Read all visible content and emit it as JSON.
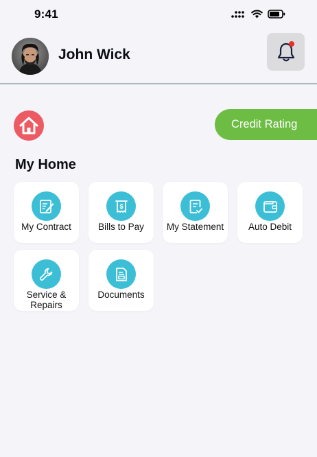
{
  "status_bar": {
    "time": "9:41"
  },
  "header": {
    "user_name": "John Wick"
  },
  "actions": {
    "credit_rating_label": "Credit Rating"
  },
  "section": {
    "title": "My Home"
  },
  "tiles": [
    {
      "label": "My Contract",
      "icon": "contract-icon"
    },
    {
      "label": "Bills to Pay",
      "icon": "bill-icon"
    },
    {
      "label": "My Statement",
      "icon": "statement-icon"
    },
    {
      "label": "Auto Debit",
      "icon": "wallet-icon"
    },
    {
      "label_line1": "Service &",
      "label_line2": "Repairs",
      "icon": "wrench-icon"
    },
    {
      "label": "Documents",
      "icon": "document-icon"
    }
  ],
  "colors": {
    "accent_teal": "#3cbfd6",
    "credit_green": "#6dbd45",
    "home_red": "#ec5a63",
    "notification_dot": "#e8302a"
  }
}
